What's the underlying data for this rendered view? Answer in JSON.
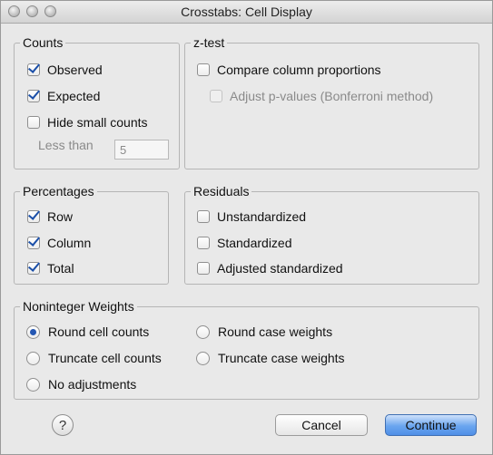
{
  "window": {
    "title": "Crosstabs: Cell Display"
  },
  "counts": {
    "legend": "Counts",
    "observed": {
      "label": "Observed",
      "checked": true
    },
    "expected": {
      "label": "Expected",
      "checked": true
    },
    "hide_small": {
      "label": "Hide small counts",
      "checked": false
    },
    "less_than_label": "Less than",
    "less_than_value": "5"
  },
  "ztest": {
    "legend": "z-test",
    "compare": {
      "label": "Compare column proportions",
      "checked": false
    },
    "adjust": {
      "label": "Adjust p-values (Bonferroni method)",
      "checked": false
    }
  },
  "percentages": {
    "legend": "Percentages",
    "row": {
      "label": "Row",
      "checked": true
    },
    "column": {
      "label": "Column",
      "checked": true
    },
    "total": {
      "label": "Total",
      "checked": true
    }
  },
  "residuals": {
    "legend": "Residuals",
    "unstandardized": {
      "label": "Unstandardized",
      "checked": false
    },
    "standardized": {
      "label": "Standardized",
      "checked": false
    },
    "adjusted": {
      "label": "Adjusted standardized",
      "checked": false
    }
  },
  "weights": {
    "legend": "Noninteger Weights",
    "round_cell": {
      "label": "Round cell counts",
      "selected": true
    },
    "round_case": {
      "label": "Round case weights",
      "selected": false
    },
    "truncate_cell": {
      "label": "Truncate cell counts",
      "selected": false
    },
    "truncate_case": {
      "label": "Truncate case weights",
      "selected": false
    },
    "none": {
      "label": "No adjustments",
      "selected": false
    }
  },
  "footer": {
    "help": "?",
    "cancel": "Cancel",
    "continue": "Continue"
  }
}
